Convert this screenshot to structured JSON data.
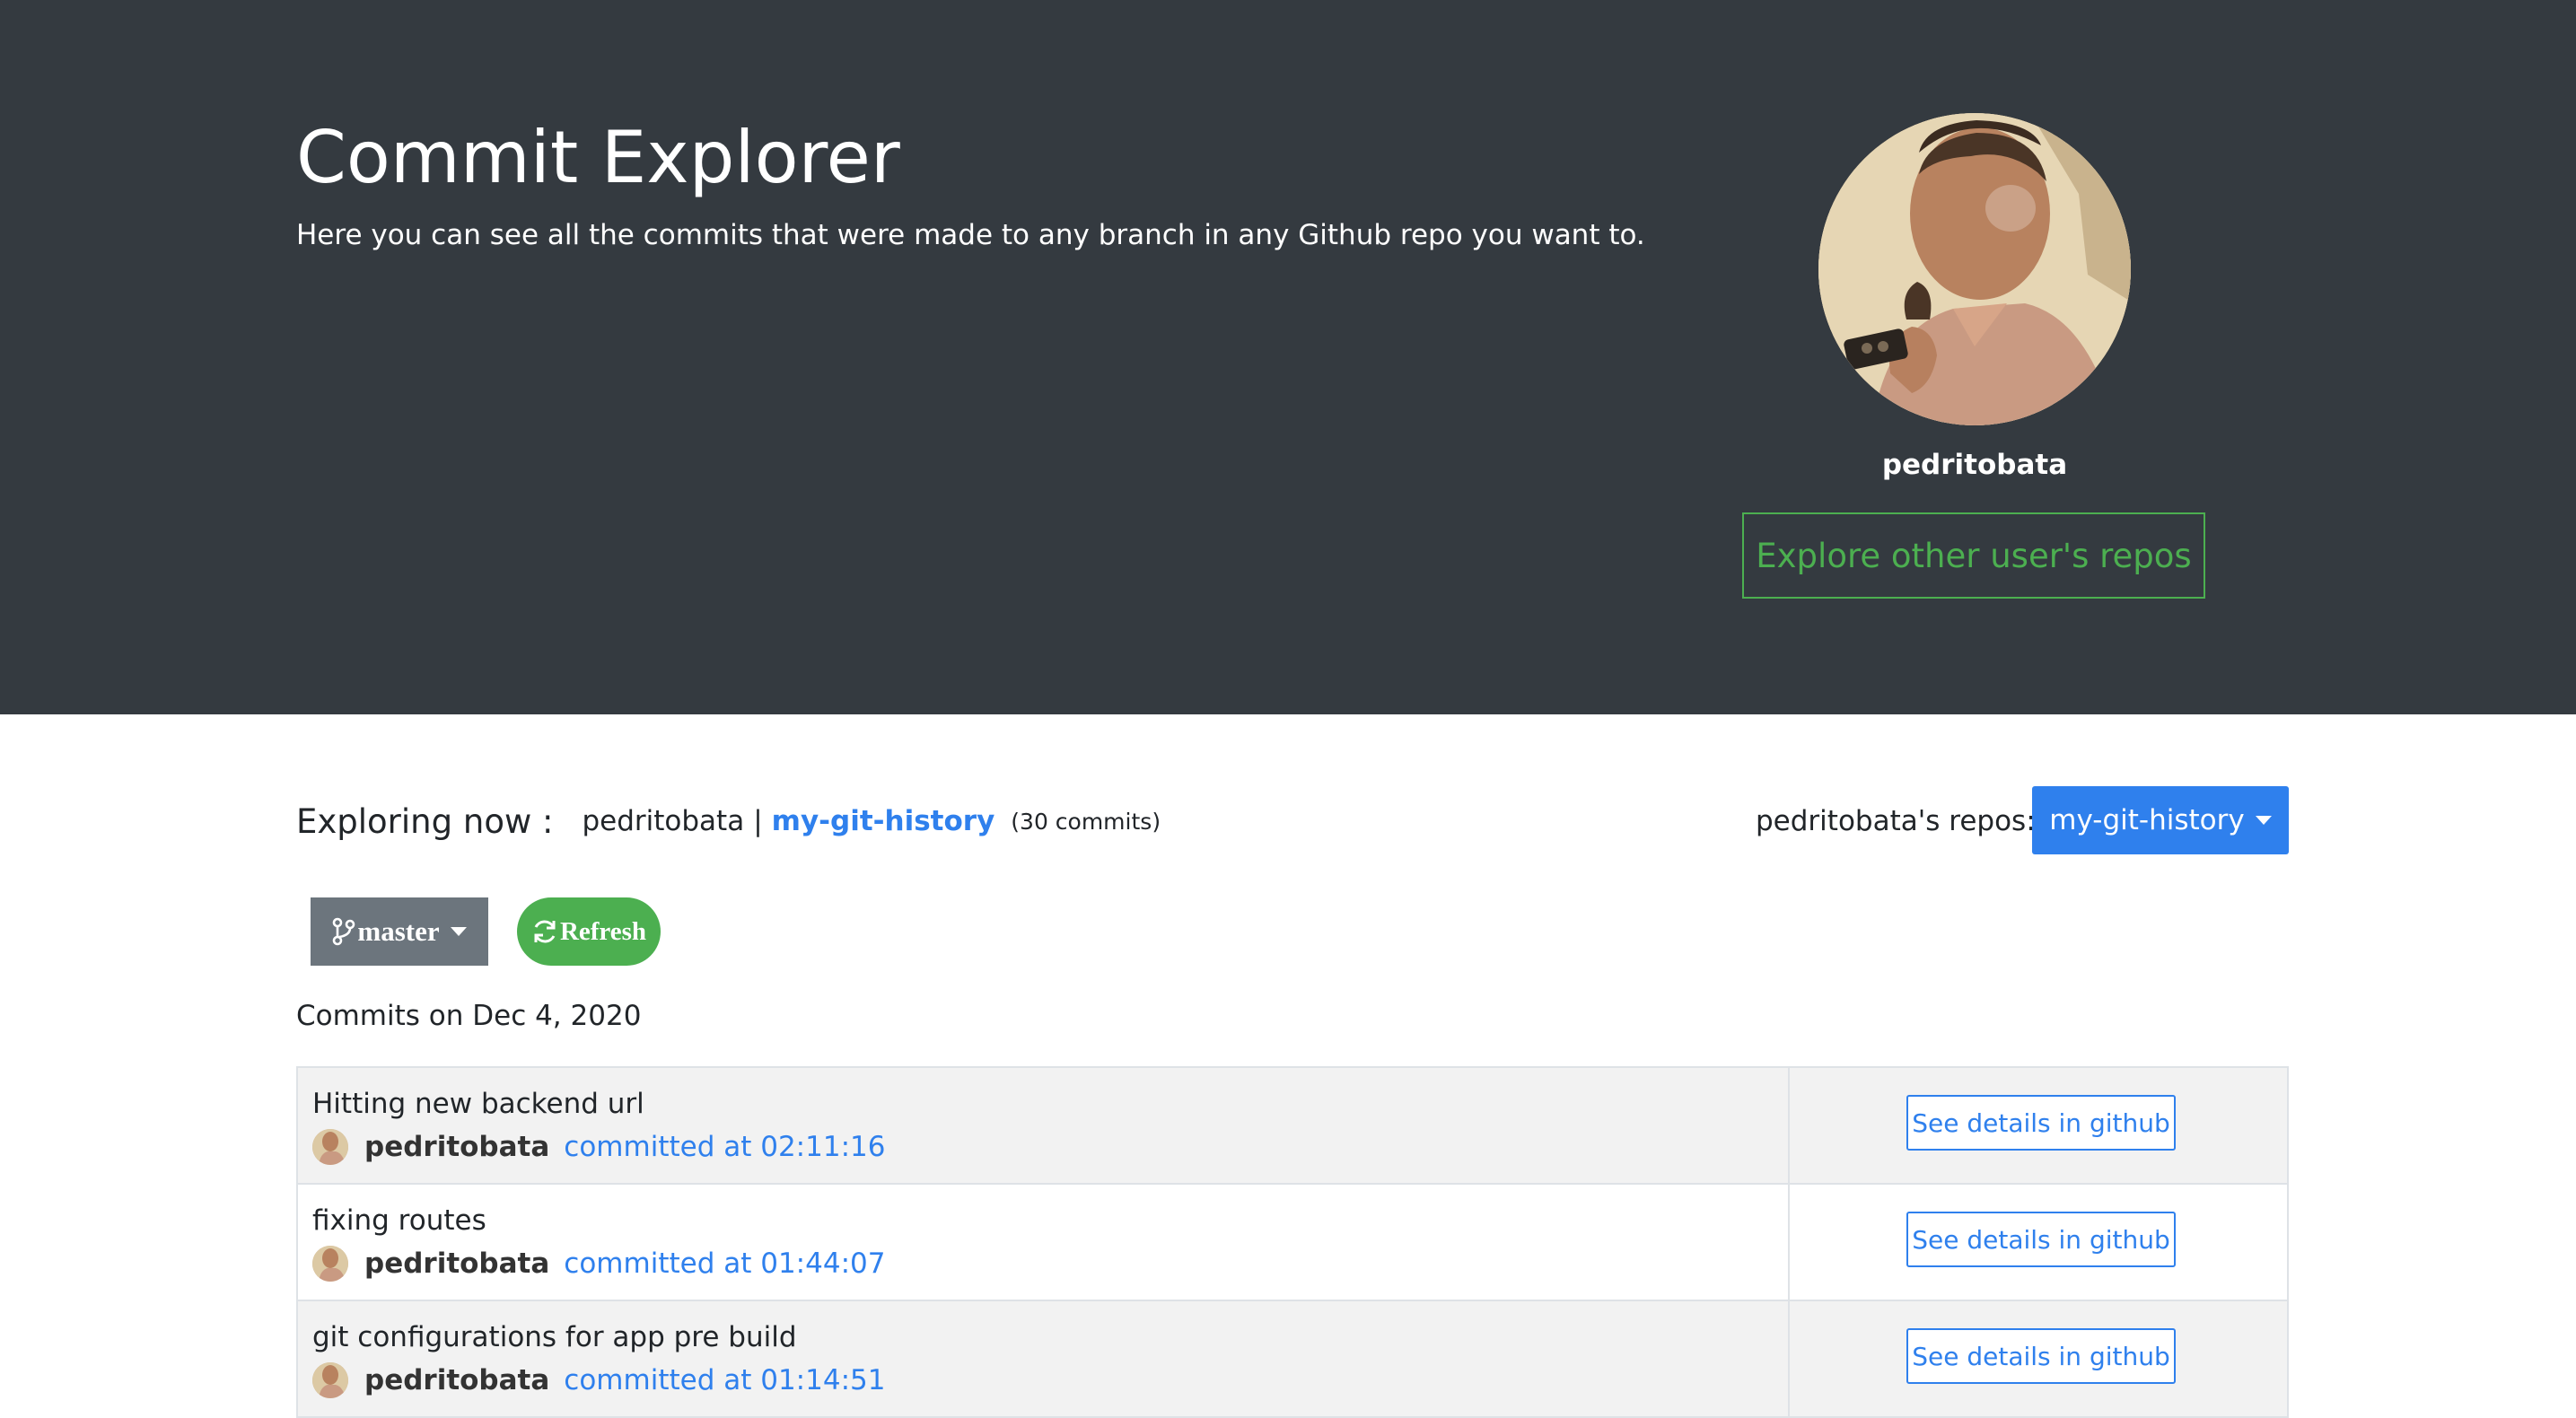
{
  "header": {
    "title": "Commit Explorer",
    "lead": "Here you can see all the commits that were made to any branch in any Github repo you want to."
  },
  "profile": {
    "username": "pedritobata",
    "explore_button": "Explore other user's repos"
  },
  "exploring": {
    "label": "Exploring now :",
    "owner": "pedritobata",
    "separator": "|",
    "repo": "my-git-history",
    "commit_count": "(30 commits)"
  },
  "repos": {
    "label": "pedritobata's repos:",
    "selected": "my-git-history"
  },
  "toolbar": {
    "branch": "master",
    "refresh": "Refresh"
  },
  "commits_date": "Commits on Dec 4, 2020",
  "commits": [
    {
      "message": "Hitting new backend url",
      "author": "pedritobata",
      "time": "committed at 02:11:16",
      "action": "See details in github"
    },
    {
      "message": "fixing routes",
      "author": "pedritobata",
      "time": "committed at 01:44:07",
      "action": "See details in github"
    },
    {
      "message": "git configurations for app pre build",
      "author": "pedritobata",
      "time": "committed at 01:14:51",
      "action": "See details in github"
    }
  ],
  "colors": {
    "hero_bg": "#343a40",
    "primary": "#2f80ed",
    "success": "#4caf50",
    "secondary": "#6c757d",
    "row_stripe": "#f2f2f2"
  },
  "icons": {
    "branch": "git-branch-icon",
    "refresh": "refresh-icon",
    "caret": "caret-down-icon"
  }
}
